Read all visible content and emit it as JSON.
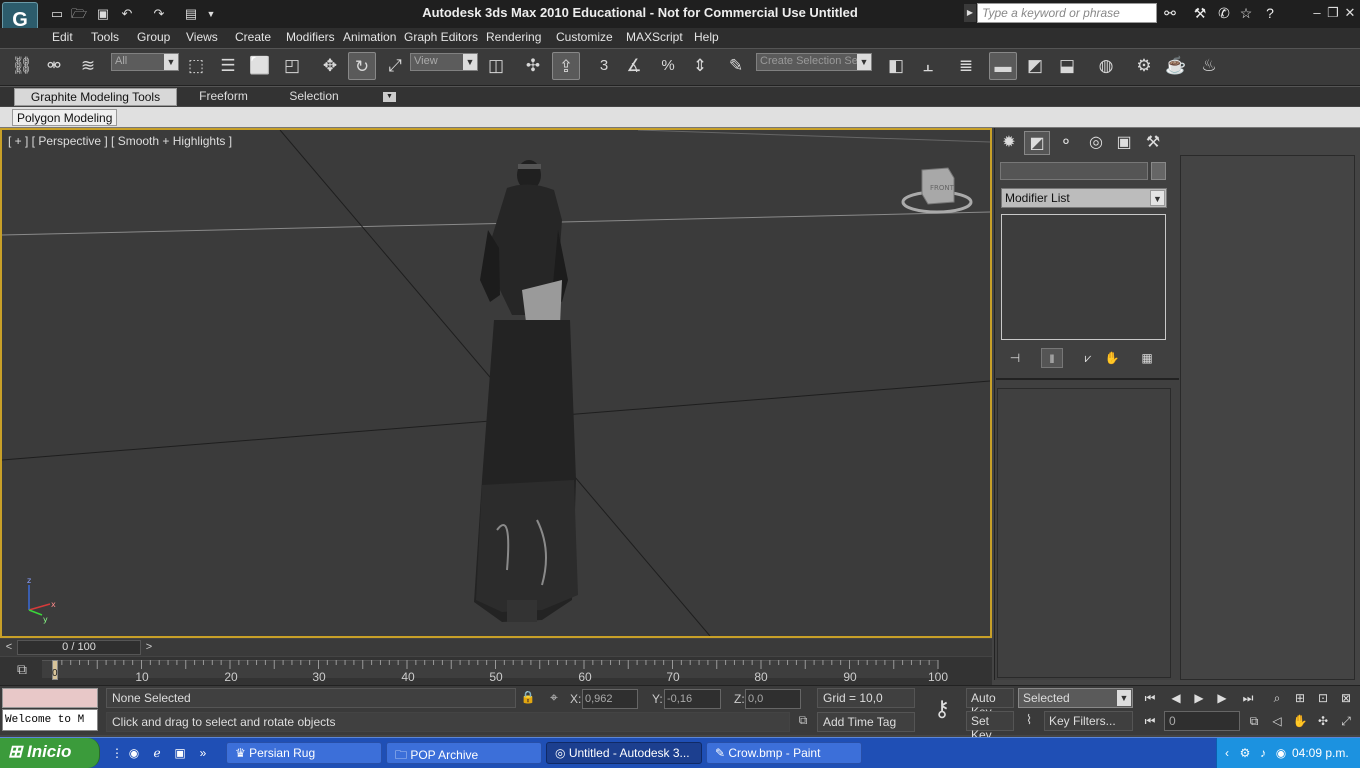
{
  "app": {
    "logo_glyph": "G",
    "title": "Autodesk 3ds Max  2010    Educational - Not for Commercial Use    Untitled"
  },
  "quick_access": [
    "new-file-icon",
    "open-file-icon",
    "save-icon",
    "undo-icon",
    "redo-icon",
    "project-icon"
  ],
  "search": {
    "placeholder": "Type a keyword or phrase"
  },
  "menus": [
    "Edit",
    "Tools",
    "Group",
    "Views",
    "Create",
    "Modifiers",
    "Animation",
    "Graph Editors",
    "Rendering",
    "Customize",
    "MAXScript",
    "Help"
  ],
  "toolbar": {
    "filter_value": "All",
    "refcoord_value": "View",
    "selection_set_placeholder": "Create Selection Se",
    "snap_label": "3",
    "angle_snap_label": "%"
  },
  "ribbon": {
    "tabs": [
      "Graphite Modeling Tools",
      "Freeform",
      "Selection"
    ],
    "panel_label": "Polygon Modeling"
  },
  "viewport": {
    "label": "[ + ] [ Perspective ] [ Smooth + Highlights ]",
    "viewcube_face": "FRONT",
    "axis_z": "z",
    "axis_x": "x",
    "axis_y": "y"
  },
  "command_panel": {
    "modifier_list": "Modifier List"
  },
  "timeline": {
    "frame_display": "0 / 100",
    "ticks": [
      "10",
      "20",
      "30",
      "40",
      "50",
      "60",
      "70",
      "80",
      "90",
      "100"
    ],
    "current_frame_marker": "0"
  },
  "status": {
    "maxscript_listener": "Welcome to M",
    "selection_info": "None Selected",
    "prompt": "Click and drag to select and rotate objects",
    "x_label": "X:",
    "x_value": "0,962",
    "y_label": "Y:",
    "y_value": "-0,16",
    "z_label": "Z:",
    "z_value": "0,0",
    "grid": "Grid = 10,0",
    "add_time_tag": "Add Time Tag",
    "auto_key": "Auto Key",
    "set_key": "Set Key",
    "key_mode": "Selected",
    "key_filters": "Key Filters...",
    "current_frame": "0"
  },
  "taskbar": {
    "start": "Inicio",
    "items": [
      "Persian Rug",
      "POP Archive",
      "Untitled - Autodesk 3...",
      "Crow.bmp - Paint"
    ],
    "clock": "04:09 p.m."
  }
}
